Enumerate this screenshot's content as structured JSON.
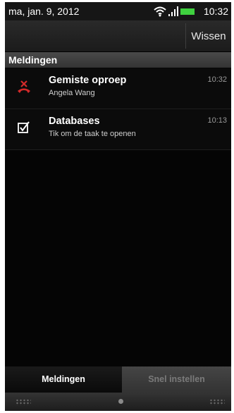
{
  "status_bar": {
    "date": "ma, jan. 9, 2012",
    "time": "10:32",
    "icons": [
      "wifi-icon",
      "signal-icon",
      "battery-icon"
    ]
  },
  "action_bar": {
    "clear_label": "Wissen"
  },
  "section": {
    "title": "Meldingen"
  },
  "notifications": [
    {
      "icon": "missed-call-icon",
      "title": "Gemiste oproep",
      "subtitle": "Angela Wang",
      "time": "10:32"
    },
    {
      "icon": "task-checkbox-icon",
      "title": "Databases",
      "subtitle": "Tik om de taak te openen",
      "time": "10:13"
    }
  ],
  "tabs": [
    {
      "label": "Meldingen",
      "active": true
    },
    {
      "label": "Snel instellen",
      "active": false
    }
  ],
  "colors": {
    "missed_call_red": "#d42a2a",
    "battery_green": "#3fd13f",
    "background": "#050505"
  }
}
